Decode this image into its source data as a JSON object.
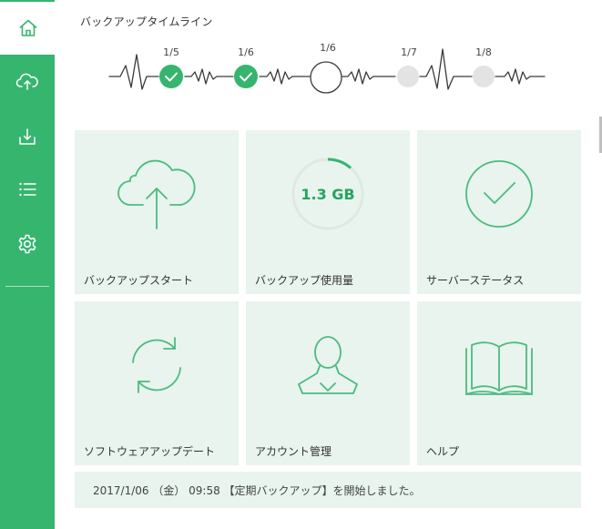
{
  "sidebar": {
    "items": [
      {
        "icon": "home-icon",
        "active": true
      },
      {
        "icon": "cloud-upload-icon",
        "active": false
      },
      {
        "icon": "download-icon",
        "active": false
      },
      {
        "icon": "list-icon",
        "active": false
      },
      {
        "icon": "gear-icon",
        "active": false
      }
    ]
  },
  "timeline": {
    "title": "バックアップタイムライン",
    "nodes": [
      {
        "label": "1/5",
        "state": "done"
      },
      {
        "label": "1/6",
        "state": "done"
      },
      {
        "label": "1/6",
        "state": "current"
      },
      {
        "label": "1/7",
        "state": "pending"
      },
      {
        "label": "1/8",
        "state": "pending"
      }
    ]
  },
  "tiles": [
    {
      "label": "バックアップスタート",
      "icon": "cloud-upload-icon"
    },
    {
      "label": "バックアップ使用量",
      "icon": "usage-gauge",
      "gauge_value": "1.3 GB"
    },
    {
      "label": "サーバーステータス",
      "icon": "check-circle-icon"
    },
    {
      "label": "ソフトウェアアップデート",
      "icon": "refresh-icon"
    },
    {
      "label": "アカウント管理",
      "icon": "user-icon"
    },
    {
      "label": "ヘルプ",
      "icon": "book-icon"
    }
  ],
  "status": {
    "message": "2017/1/06 （金） 09:58 【定期バックアップ】を開始しました。"
  },
  "colors": {
    "accent": "#35b56e",
    "tile_bg": "#e8f4ed",
    "icon_stroke": "#4cbb7f",
    "pending_node": "#e3e3e3"
  }
}
